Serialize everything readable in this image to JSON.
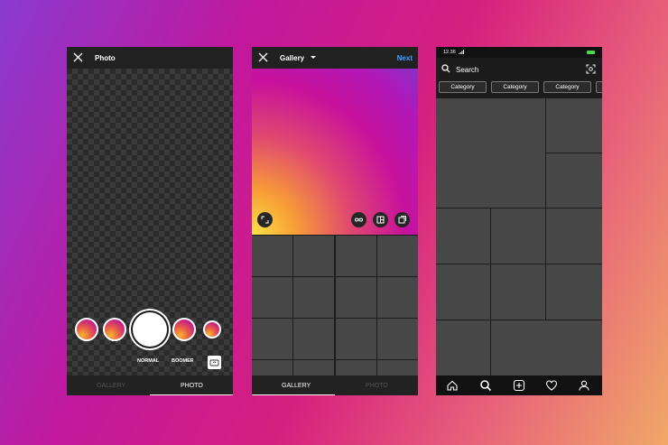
{
  "camera": {
    "title": "Photo",
    "modes": [
      "NORMAL",
      "BOOMERANG"
    ],
    "tabs": [
      "GALLERY",
      "PHOTO"
    ],
    "active_tab": "PHOTO"
  },
  "gallery": {
    "title": "Gallery",
    "next_label": "Next",
    "tabs": [
      "GALLERY",
      "PHOTO"
    ],
    "active_tab": "GALLERY"
  },
  "explore": {
    "status_time": "12.36",
    "search_placeholder": "Search",
    "categories": [
      "Category",
      "Category",
      "Category"
    ]
  },
  "colors": {
    "accent_blue": "#3f9fff",
    "battery": "#4bd84b",
    "panel": "#1c1c1c",
    "cell": "#474747"
  },
  "icons": [
    "close-icon",
    "caret-down-icon",
    "flip-camera-icon",
    "expand-icon",
    "infinity-icon",
    "layout-icon",
    "multi-select-icon",
    "search-icon",
    "scan-icon",
    "home-icon",
    "add-icon",
    "heart-icon",
    "profile-icon"
  ]
}
